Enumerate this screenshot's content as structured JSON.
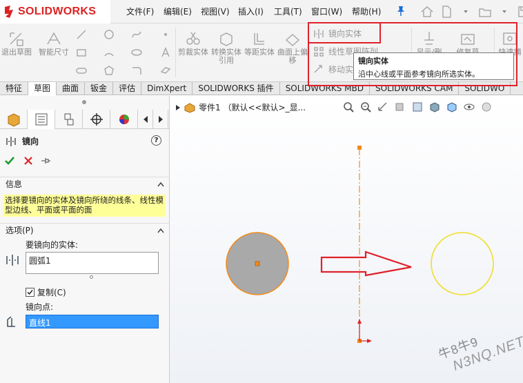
{
  "app": {
    "logo_text": "SOLIDWORKS",
    "menus": [
      "文件(F)",
      "编辑(E)",
      "视图(V)",
      "插入(I)",
      "工具(T)",
      "窗口(W)",
      "帮助(H)"
    ]
  },
  "ribbon": {
    "big_buttons": [
      {
        "label": "退出草图",
        "icon": "exit-sketch-icon"
      },
      {
        "label": "智能尺寸",
        "icon": "smart-dimension-icon"
      },
      {
        "label": "剪裁实体",
        "icon": "trim-icon"
      },
      {
        "label": "转换实体引用",
        "icon": "convert-entities-icon"
      },
      {
        "label": "等距实体",
        "icon": "offset-entities-icon"
      },
      {
        "label": "曲面上偏移",
        "icon": "offset-on-surface-icon"
      },
      {
        "label": "显示/删除",
        "icon": "display-delete-relations-icon"
      },
      {
        "label": "修复草",
        "icon": "repair-sketch-icon"
      },
      {
        "label": "快速捕",
        "icon": "quick-snaps-icon"
      }
    ],
    "mirror_items": [
      {
        "label": "镜向实体",
        "icon": "mirror-entities-icon"
      },
      {
        "label": "线性草图阵列",
        "icon": "linear-pattern-icon"
      },
      {
        "label": "移动实",
        "icon": "move-entities-icon"
      }
    ]
  },
  "tooltip": {
    "title": "镜向实体",
    "description": "沿中心线或平面参考镜向所选实体。"
  },
  "tabs": [
    "特征",
    "草图",
    "曲面",
    "钣金",
    "评估",
    "DimXpert",
    "SOLIDWORKS 插件",
    "SOLIDWORKS MBD",
    "SOLIDWORKS CAM",
    "SOLIDWO"
  ],
  "active_tab": "草图",
  "property_manager": {
    "title": "镜向",
    "info_header": "信息",
    "info_message": "选择要镜向的实体及镜向所绕的线条、线性模型边线、平面或平面的面",
    "options_header": "选项(P)",
    "entities_label": "要镜向的实体:",
    "entities_value": "圆弧1",
    "copy_label": "复制(C)",
    "copy_checked": true,
    "mirror_about_label": "镜向点:",
    "mirror_about_value": "直线1"
  },
  "graphics": {
    "tree_label": "零件1 （默认<<默认>_显...",
    "source_circle_fill": "#a9a9a9",
    "source_circle_stroke": "#f28a1c",
    "mirrored_circle_stroke": "#f0e040",
    "centerline_color": "#f28a1c",
    "arrow_color": "#e0202a",
    "watermark_line1": "牛8牛9",
    "watermark_line2": "N3NQ.NET"
  },
  "colors": {
    "highlight": "#e0202a",
    "info_bg": "#ffff99",
    "selected_field_bg": "#3399ff",
    "brand_red": "#d22222"
  }
}
